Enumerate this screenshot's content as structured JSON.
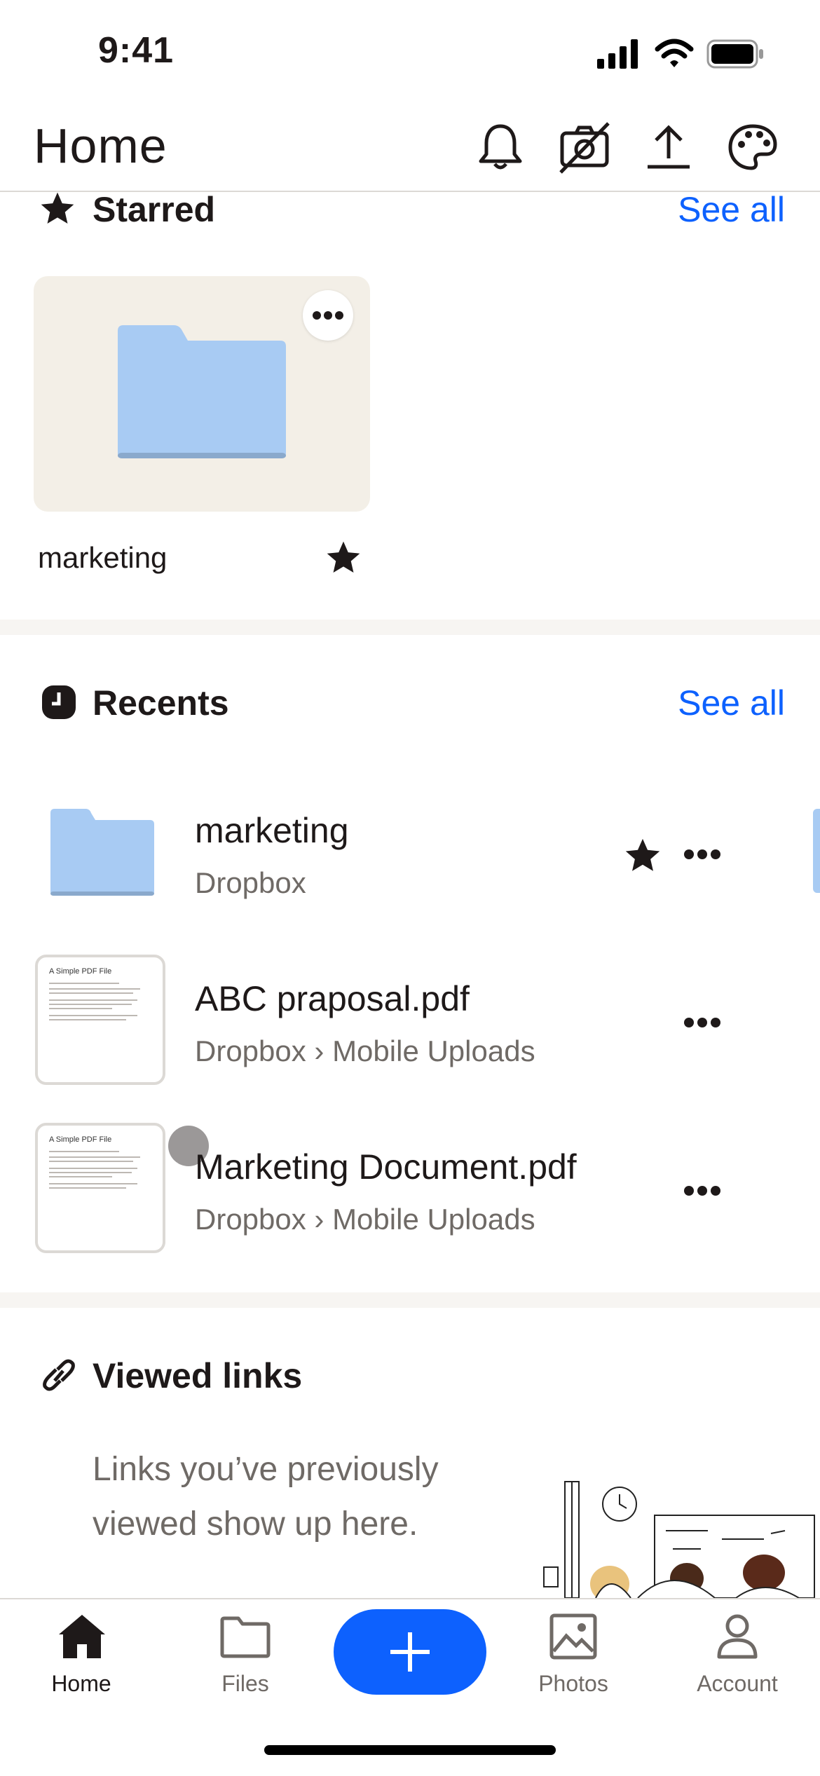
{
  "status": {
    "time": "9:41"
  },
  "header": {
    "title": "Home"
  },
  "starred": {
    "title": "Starred",
    "see_all": "See all",
    "items": [
      {
        "name": "marketing"
      }
    ]
  },
  "recents": {
    "title": "Recents",
    "see_all": "See all",
    "items": [
      {
        "name": "marketing",
        "subtitle": "Dropbox"
      },
      {
        "name": "ABC praposal.pdf",
        "subtitle": "Dropbox › Mobile Uploads",
        "thumb_title": "A Simple PDF File"
      },
      {
        "name": "Marketing Document.pdf",
        "subtitle": "Dropbox › Mobile Uploads",
        "thumb_title": "A Simple PDF File"
      }
    ]
  },
  "viewed_links": {
    "title": "Viewed links",
    "empty_text": "Links you’ve previously viewed show up here."
  },
  "tabs": [
    {
      "label": "Home"
    },
    {
      "label": "Files"
    },
    {
      "label": "Photos"
    },
    {
      "label": "Account"
    }
  ],
  "colors": {
    "accent": "#0d61fe",
    "folder": "#a8cbf3",
    "card_bg": "#f3efe7"
  }
}
